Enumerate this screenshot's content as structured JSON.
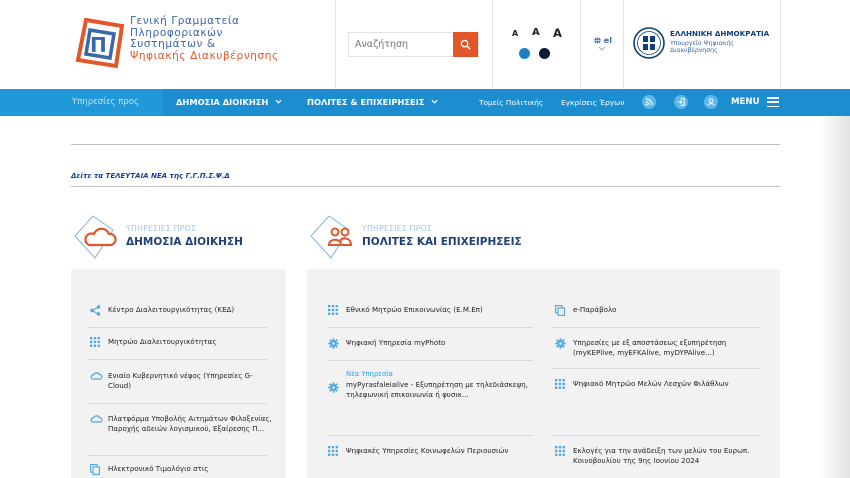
{
  "header": {
    "logo_lines": [
      "Γενική Γραμματεία",
      "Πληροφοριακών",
      "Συστημάτων &",
      "Ψηφιακής Διακυβέρνησης"
    ],
    "search_placeholder": "Αναζήτηση",
    "font_sizes": [
      "A",
      "A",
      "A"
    ],
    "language": "el",
    "gov_title": "ΕΛΛΗΝΙΚΗ ΔΗΜΟΚΡΑΤΙΑ",
    "gov_sub_1": "Υπουργείο Ψηφιακής",
    "gov_sub_2": "Διακυβέρνησης",
    "colors": {
      "accent": "#e2572a",
      "brand_blue": "#1c8ed0",
      "contrast_blue": "#1b82c4",
      "contrast_dark": "#0d1a33"
    }
  },
  "nav": {
    "services_for": "Υπηρεσίες προς",
    "public_admin": "ΔΗΜΟΣΙΑ ΔΙΟΙΚΗΣΗ",
    "citizens": "ΠΟΛΙΤΕΣ & ΕΠΙΧΕΙΡΗΣΕΙΣ",
    "policy_areas": "Τομείς Πολιτικής",
    "approvals": "Εγκρίσεις Έργων",
    "menu": "MENU",
    "icons": [
      "rss-icon",
      "login-icon",
      "user-icon"
    ]
  },
  "news_link": "Δείτε τα ΤΕΛΕΥΤΑΙΑ ΝΕΑ της Γ.Γ.Π.Σ.Ψ.Δ",
  "left_section": {
    "pre": "ΥΠΗΡΕΣΙΕΣ ΠΡΟΣ",
    "title": "ΔΗΜΟΣΙΑ ΔΙΟΙΚΗΣΗ",
    "items": [
      {
        "icon": "share-icon",
        "label": "Κέντρο Διαλειτουργικότητας (ΚΕΔ)"
      },
      {
        "icon": "grid-icon",
        "label": "Μητρώο Διαλειτουργικότητας"
      },
      {
        "icon": "cloud-icon",
        "label": "Ενιαίο Κυβερνητικό νέφος (Υπηρεσίες G-Cloud)"
      },
      {
        "icon": "cloud-icon",
        "label": "Πλατφόρμα Υποβολής Αιτημάτων Φιλοξενίας, Παροχής αδειών λογισμικού, Εξαίρεσης Π..."
      },
      {
        "icon": "copy-icon",
        "label": "Ηλεκτρονικό Τιμολόγιο στις"
      }
    ]
  },
  "right_section": {
    "pre": "ΥΠΗΡΕΣΙΕΣ ΠΡΟΣ",
    "title": "ΠΟΛΙΤΕΣ ΚΑΙ ΕΠΙΧΕΙΡΗΣΕΙΣ",
    "col1": [
      {
        "icon": "grid-icon",
        "label": "Εθνικό Μητρώο Επικοινωνίας (Ε.Μ.Επ)"
      },
      {
        "icon": "gear-icon",
        "label": "Ψηφιακή Υπηρεσία myPhoto"
      },
      {
        "icon": "gear-icon",
        "tag": "Νέα Υπηρεσία",
        "label": "myPyrasfaleialive - Εξυπηρέτηση με τηλεδιάσκεψη, τηλεφωνική επικοινωνία ή φυσικ..."
      },
      {
        "icon": "grid-icon",
        "label": "Ψηφιακές Υπηρεσίες Κοινωφελών Περιουσιών"
      }
    ],
    "col2": [
      {
        "icon": "copy-icon",
        "label": "e-Παράβολο"
      },
      {
        "icon": "gear-icon",
        "label": "Υπηρεσίες με εξ αποστάσεως εξυπηρέτηση (myKEPlive, myEFKAlive, myDYPAlive...)"
      },
      {
        "icon": "grid-icon",
        "label": "Ψηφιακό Μητρώο Μελών Λεσχών Φιλάθλων"
      },
      {
        "icon": "grid-icon",
        "label": "Εκλογές για την ανάδειξη των μελών του Ευρωπ. Κοινοβουλίου της 9ης Ιουνίου 2024"
      }
    ]
  }
}
